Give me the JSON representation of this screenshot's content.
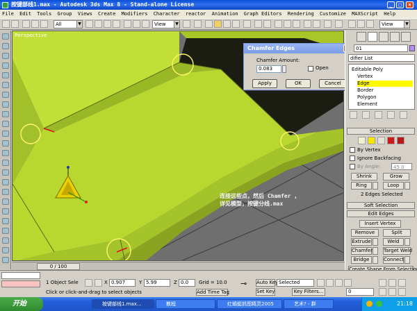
{
  "title_bar": {
    "text": "按键部线1.max - Autodesk 3ds Max 8 - Stand-alone License",
    "minimize": "_",
    "maximize": "□",
    "close": "×"
  },
  "menu": [
    "File",
    "Edit",
    "Tools",
    "Group",
    "Views",
    "Create",
    "Modifiers",
    "Character",
    "reactor",
    "Animation",
    "Graph Editors",
    "Rendering",
    "Customize",
    "MAXScript",
    "Help"
  ],
  "toolbar": {
    "selection_filter": "All",
    "ref_coord": "View",
    "ref_coord_right": "View"
  },
  "viewport": {
    "label": "Perspective",
    "annotation_line1": "连接这些点，然后 Chamfer ，",
    "annotation_line2": "详见模型，按键分线.max"
  },
  "chamfer_dialog": {
    "title": "Chamfer Edges",
    "amount_label": "Chamfer Amount:",
    "amount_value": "0.083",
    "open_label": "Open",
    "apply": "Apply",
    "ok": "OK",
    "cancel": "Cancel"
  },
  "command_panel": {
    "object_name": "01",
    "modifier_list": "difier List",
    "stack": [
      "Editable Poly",
      "Vertex",
      "Edge",
      "Border",
      "Polygon",
      "Element"
    ],
    "selection": {
      "header": "Selection",
      "by_vertex": "By Vertex",
      "ignore_backfacing": "Ignore Backfacing",
      "by_angle": "By Angle:",
      "angle_value": "45.0",
      "shrink": "Shrink",
      "grow": "Grow",
      "ring": "Ring",
      "loop": "Loop",
      "status": "2 Edges Selected"
    },
    "soft_selection": "Soft Selection",
    "edit_edges": {
      "header": "Edit Edges",
      "insert_vertex": "Insert Vertex",
      "remove": "Remove",
      "split": "Split",
      "extrude": "Extrude",
      "weld": "Weld",
      "chamfer": "Chamfer",
      "target_weld": "Target Weld",
      "bridge": "Bridge",
      "connect": "Connect",
      "create_shape": "Create Shape From Selection"
    }
  },
  "timeline": {
    "slider": "0 / 100"
  },
  "status": {
    "selection": "1 Object Sele",
    "x_label": "X",
    "x_value": "0.907",
    "y_label": "Y",
    "y_value": "5.99",
    "z_label": "Z",
    "z_value": "0.0",
    "grid": "Grid = 10.0",
    "auto_key": "Auto Key",
    "key_mode": "Selected",
    "set_key": "Set Key",
    "key_filters": "Key Filters...",
    "prompt": "Click or click-and-drag to select objects",
    "add_time_tag": "Add Time Tag",
    "frame": "0"
  },
  "taskbar": {
    "start": "开始",
    "tasks": [
      "按键部线1.max...",
      "教程",
      "红蜻蜓抓图精灵2005",
      "艺术? - 群"
    ],
    "clock": "21:18"
  },
  "colors": {
    "poly_green": "#b4d62e",
    "dark_wall": "#1b1d12",
    "ground_gray": "#6f6f6f",
    "highlight_yellow": "#fffa00",
    "title_blue": "#0a4fd6"
  }
}
